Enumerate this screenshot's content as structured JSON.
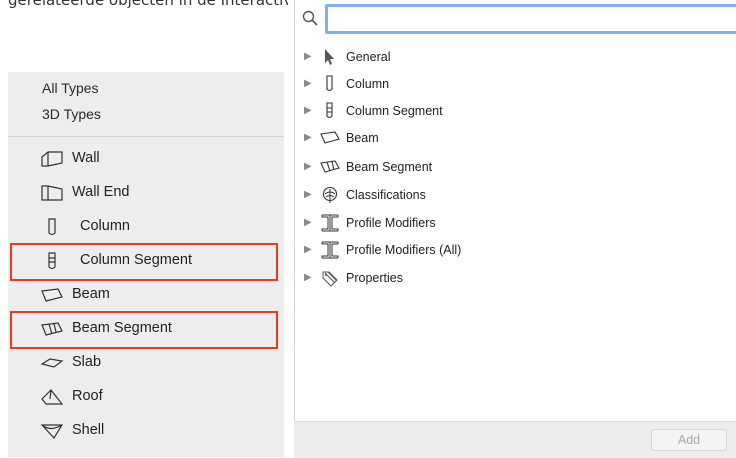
{
  "caption": "gerelateerde objecten in de Interactive Schedule op Lower segment als elementtype.",
  "left_panel": {
    "groups": [
      "All Types",
      "3D Types"
    ],
    "items": [
      {
        "label": "Wall",
        "icon": "wall-icon",
        "highlighted": false
      },
      {
        "label": "Wall End",
        "icon": "wall-end-icon",
        "highlighted": false
      },
      {
        "label": "Column",
        "icon": "column-icon",
        "highlighted": false
      },
      {
        "label": "Column Segment",
        "icon": "column-segment-icon",
        "highlighted": true
      },
      {
        "label": "Beam",
        "icon": "beam-icon",
        "highlighted": false
      },
      {
        "label": "Beam Segment",
        "icon": "beam-segment-icon",
        "highlighted": true
      },
      {
        "label": "Slab",
        "icon": "slab-icon",
        "highlighted": false
      },
      {
        "label": "Roof",
        "icon": "roof-icon",
        "highlighted": false
      },
      {
        "label": "Shell",
        "icon": "shell-icon",
        "highlighted": false
      }
    ],
    "highlight_color": "#e53b1e"
  },
  "right_panel": {
    "search": {
      "value": "",
      "placeholder": "",
      "icon": "search-icon"
    },
    "tree": [
      {
        "label": "General",
        "icon": "cursor-arrow-icon"
      },
      {
        "label": "Column",
        "icon": "column-icon"
      },
      {
        "label": "Column Segment",
        "icon": "column-segment-icon"
      },
      {
        "label": "Beam",
        "icon": "beam-icon"
      },
      {
        "label": "Beam Segment",
        "icon": "beam-segment-icon"
      },
      {
        "label": "Classifications",
        "icon": "classification-icon"
      },
      {
        "label": "Profile Modifiers",
        "icon": "profile-i-beam-icon"
      },
      {
        "label": "Profile Modifiers (All)",
        "icon": "profile-i-beam-icon"
      },
      {
        "label": "Properties",
        "icon": "tag-icon"
      }
    ],
    "add_label": "Add"
  },
  "colors": {
    "accent": "#7fb1ee",
    "panel_bg": "#ededed"
  }
}
